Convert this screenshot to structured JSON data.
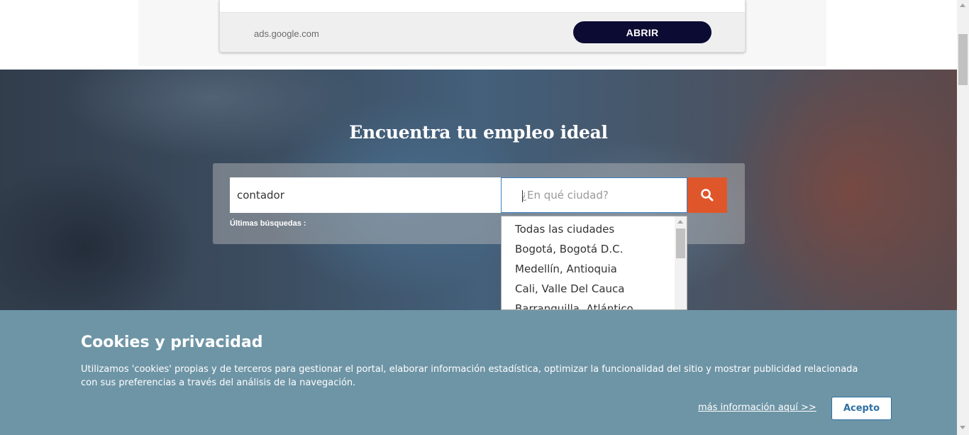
{
  "ad": {
    "domain": "ads.google.com",
    "button_label": "ABRIR"
  },
  "hero": {
    "title": "Encuentra tu empleo ideal"
  },
  "search": {
    "keyword_value": "contador",
    "city_placeholder": "¿En qué ciudad?",
    "last_searches_label": "Últimas búsquedas :",
    "button_icon": "search-icon"
  },
  "city_dropdown": {
    "options": [
      "Todas las ciudades",
      "Bogotá, Bogotá D.C.",
      "Medellín, Antioquia",
      "Cali, Valle Del Cauca",
      "Barranquilla, Atlántico"
    ]
  },
  "cookie_banner": {
    "title": "Cookies y privacidad",
    "text": "Utilizamos 'cookies' propias y de terceros para gestionar el portal, elaborar información estadística, optimizar la funcionalidad del sitio y mostrar publicidad relacionada con sus preferencias a través del análisis de la navegación.",
    "more_info_link": "más información aquí >>",
    "accept_label": "Acepto"
  },
  "colors": {
    "accent_search": "#e0562b",
    "ad_button": "#0b0b33",
    "cookie_bg": "#6e95a6",
    "accept_text": "#2d6fa3"
  }
}
